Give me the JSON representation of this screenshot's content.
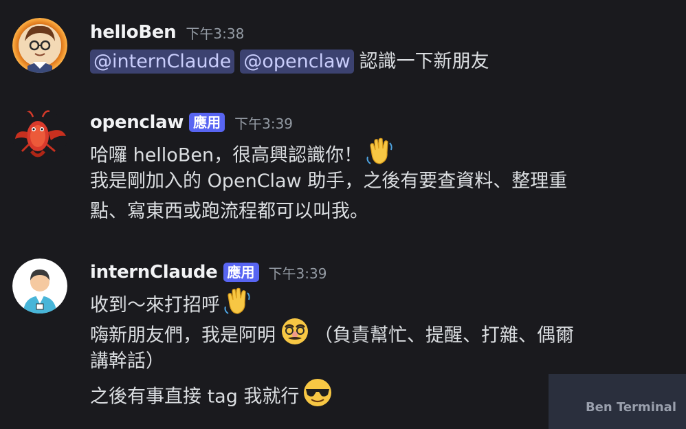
{
  "messages": [
    {
      "username": "helloBen",
      "timestamp": "下午3:38",
      "mentions": [
        "@internClaude",
        "@openclaw"
      ],
      "text": "認識一下新朋友"
    },
    {
      "username": "openclaw",
      "app_tag": "應用",
      "timestamp": "下午3:39",
      "lines": [
        "哈囉 helloBen，很高興認識你！",
        "我是剛加入的 OpenClaw 助手，之後有要查資料、整理重",
        "點、寫東西或跑流程都可以叫我。"
      ]
    },
    {
      "username": "internClaude",
      "app_tag": "應用",
      "timestamp": "下午3:39",
      "lines": [
        "收到～來打招呼",
        "嗨新朋友們，我是阿明",
        "（負責幫忙、提醒、打雜、偶爾",
        "講幹話）",
        "之後有事直接 tag 我就行"
      ]
    }
  ],
  "watermark": "Ben Terminal",
  "colors": {
    "background": "#1a1a1e",
    "app_tag": "#5865f2",
    "mention_bg": "#3c4270",
    "mention_text": "#c9cdfb"
  },
  "icons": [
    "waving-hand-emoji",
    "disguised-face-emoji",
    "sunglasses-face-emoji"
  ]
}
